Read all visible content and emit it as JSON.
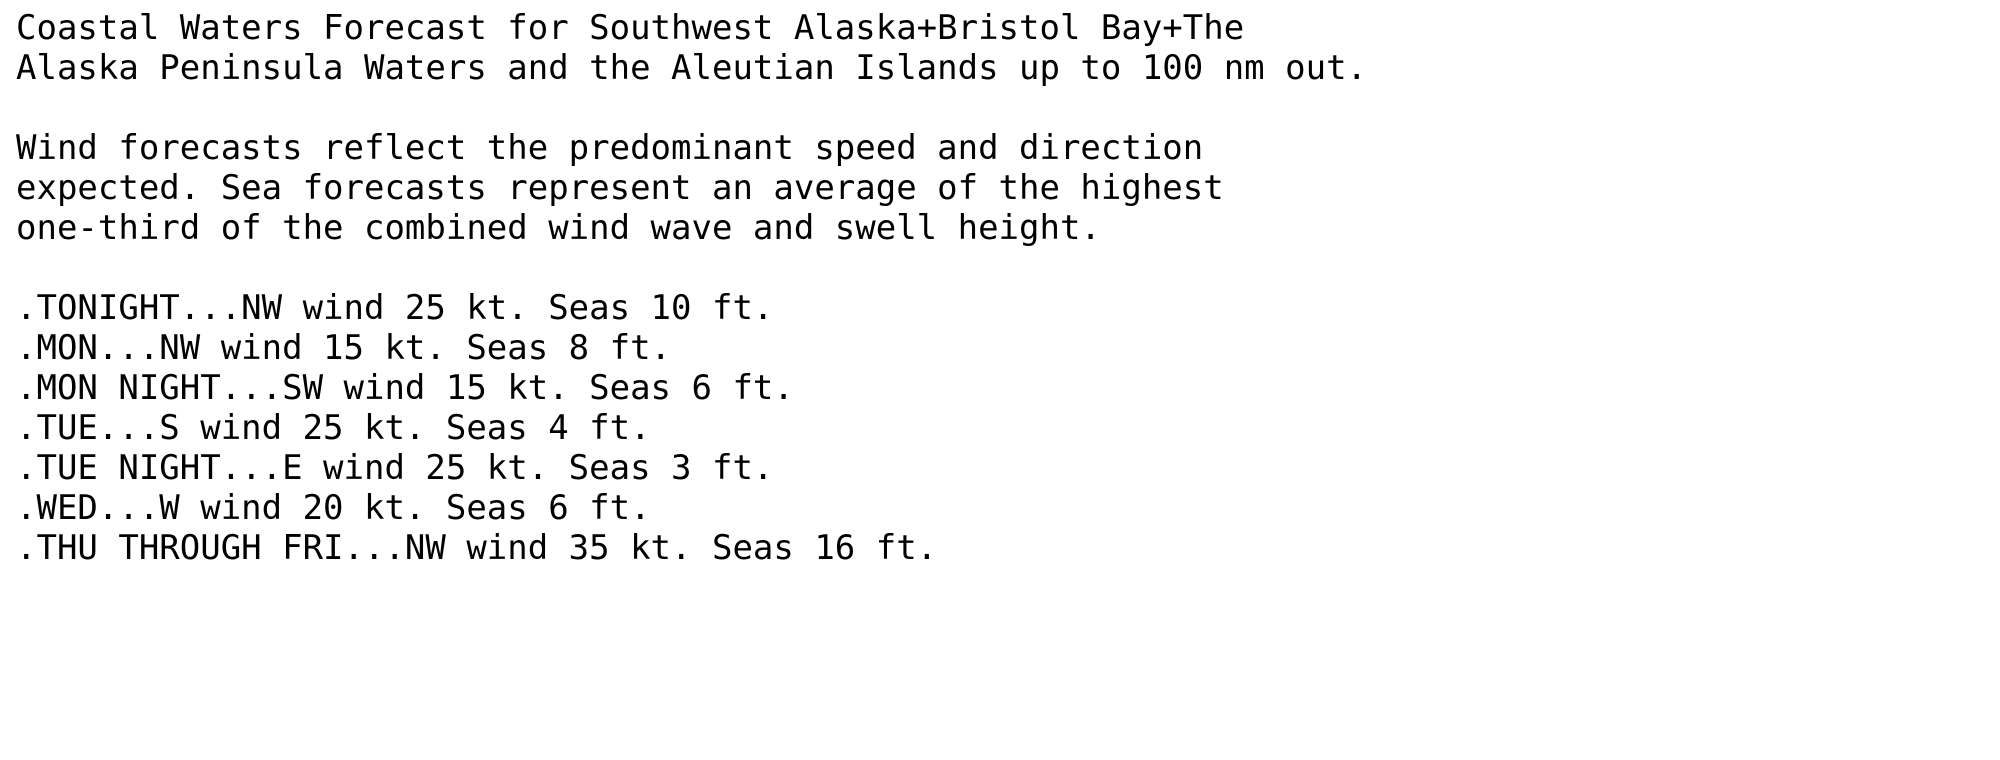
{
  "document": {
    "type": "plain-text-weather-bulletin",
    "background_color": "#ffffff",
    "text_color": "#000000",
    "header": {
      "lines": [
        "Coastal Waters Forecast for Southwest Alaska+Bristol Bay+The",
        "Alaska Peninsula Waters and the Aleutian Islands up to 100 nm out."
      ]
    },
    "disclaimer": {
      "lines": [
        "Wind forecasts reflect the predominant speed and direction",
        "expected. Sea forecasts represent an average of the highest",
        "one-third of the combined wind wave and swell height."
      ]
    },
    "forecast_periods": [
      {
        "label": ".TONIGHT...",
        "text": ".TONIGHT...NW wind 25 kt. Seas 10 ft.",
        "wind_direction": "NW",
        "wind_speed_kt": 25,
        "seas_ft": 10
      },
      {
        "label": ".MON...",
        "text": ".MON...NW wind 15 kt. Seas 8 ft.",
        "wind_direction": "NW",
        "wind_speed_kt": 15,
        "seas_ft": 8
      },
      {
        "label": ".MON NIGHT...",
        "text": ".MON NIGHT...SW wind 15 kt. Seas 6 ft.",
        "wind_direction": "SW",
        "wind_speed_kt": 15,
        "seas_ft": 6
      },
      {
        "label": ".TUE...",
        "text": ".TUE...S wind 25 kt. Seas 4 ft.",
        "wind_direction": "S",
        "wind_speed_kt": 25,
        "seas_ft": 4
      },
      {
        "label": ".TUE NIGHT...",
        "text": ".TUE NIGHT...E wind 25 kt. Seas 3 ft.",
        "wind_direction": "E",
        "wind_speed_kt": 25,
        "seas_ft": 3
      },
      {
        "label": ".WED...",
        "text": ".WED...W wind 20 kt. Seas 6 ft.",
        "wind_direction": "W",
        "wind_speed_kt": 20,
        "seas_ft": 6
      },
      {
        "label": ".THU THROUGH FRI...",
        "text": ".THU THROUGH FRI...NW wind 35 kt. Seas 16 ft.",
        "wind_direction": "NW",
        "wind_speed_kt": 35,
        "seas_ft": 16
      }
    ]
  }
}
